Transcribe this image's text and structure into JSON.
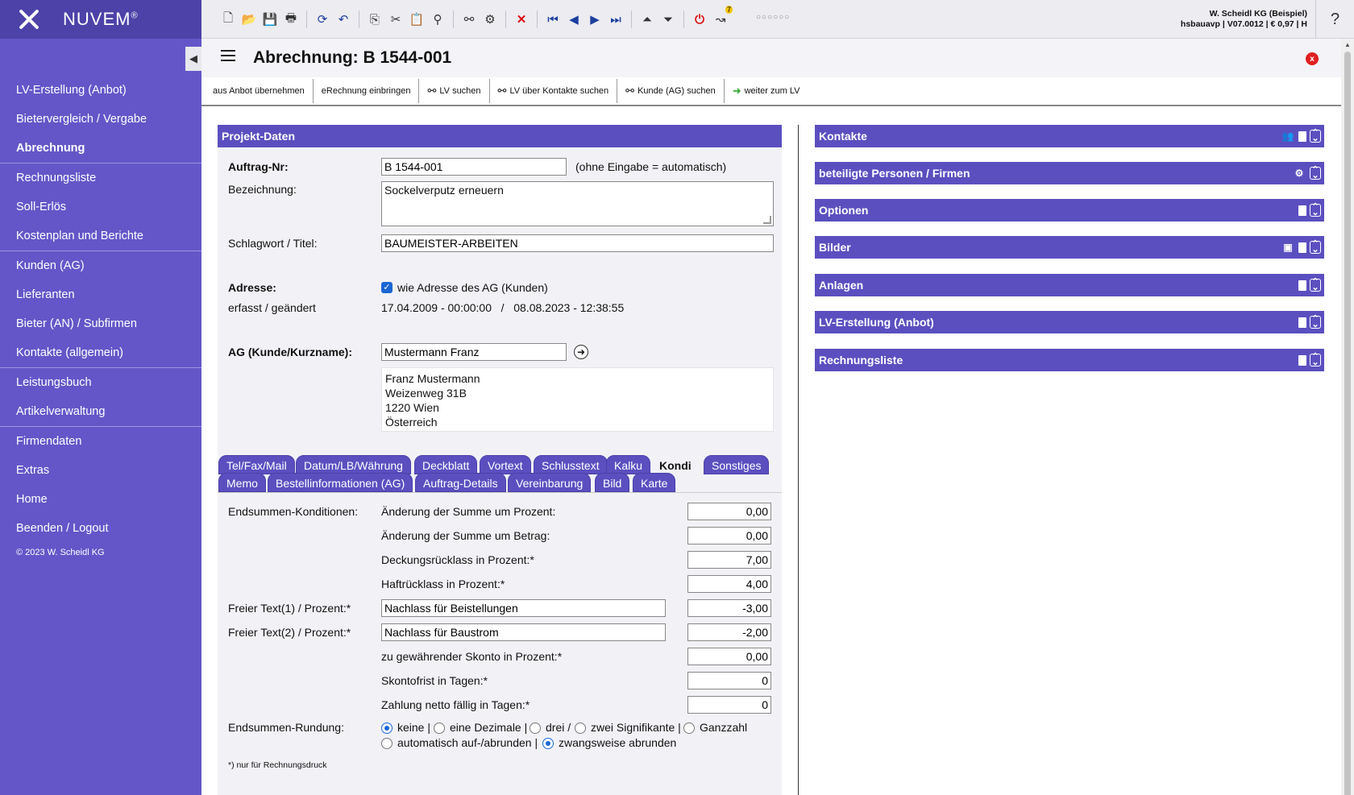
{
  "app": {
    "name": "NUVEM",
    "reg": "®"
  },
  "sidebar": {
    "items": [
      {
        "label": "LV-Erstellung (Anbot)"
      },
      {
        "label": "Bietervergleich / Vergabe"
      },
      {
        "label": "Abrechnung"
      },
      {
        "label": "Rechnungsliste"
      },
      {
        "label": "Soll-Erlös"
      },
      {
        "label": "Kostenplan und Berichte"
      },
      {
        "label": "Kunden (AG)"
      },
      {
        "label": "Lieferanten"
      },
      {
        "label": "Bieter (AN) / Subfirmen"
      },
      {
        "label": "Kontakte (allgemein)"
      },
      {
        "label": "Leistungsbuch"
      },
      {
        "label": "Artikelverwaltung"
      },
      {
        "label": "Firmendaten"
      },
      {
        "label": "Extras"
      },
      {
        "label": "Home"
      },
      {
        "label": "Beenden / Logout"
      }
    ],
    "copyright": "© 2023 W. Scheidl KG"
  },
  "topbar": {
    "company_line1": "W. Scheidl KG (Beispiel)",
    "company_line2": "hsbauavp | V07.0012 | € 0,97 | H",
    "dots": "○○○○○○",
    "help": "?",
    "badge": "7"
  },
  "header": {
    "title": "Abrechnung: B 1544-001",
    "close": "x"
  },
  "actions": [
    {
      "label": "aus Anbot übernehmen"
    },
    {
      "label": "eRechnung einbringen"
    },
    {
      "label": "LV suchen"
    },
    {
      "label": "LV über Kontakte suchen"
    },
    {
      "label": "Kunde (AG) suchen"
    },
    {
      "label": "weiter zum LV"
    }
  ],
  "projekt": {
    "title": "Projekt-Daten",
    "auftrag_label": "Auftrag-Nr:",
    "auftrag_value": "B 1544-001",
    "auftrag_hint": "(ohne Eingabe = automatisch)",
    "bezeichnung_label": "Bezeichnung:",
    "bezeichnung_value": "Sockelverputz erneuern",
    "schlagwort_label": "Schlagwort / Titel:",
    "schlagwort_value": "BAUMEISTER-ARBEITEN",
    "adresse_label": "Adresse:",
    "adresse_check": "wie Adresse des AG (Kunden)",
    "erfasst_label": "erfasst / geändert",
    "erfasst_value": "17.04.2009 - 00:00:00   /   08.08.2023 - 12:38:55",
    "ag_label": "AG (Kunde/Kurzname):",
    "ag_value": "Mustermann Franz",
    "address": [
      "Franz Mustermann",
      "Weizenweg 31B",
      "1220 Wien",
      "Österreich"
    ]
  },
  "tabs_row1": [
    "Tel/Fax/Mail",
    "Datum/LB/Währung",
    "Deckblatt",
    "Vortext",
    "Schlusstext",
    "Kalku",
    "Kondi",
    "Sonstiges"
  ],
  "tabs_row2": [
    "Memo",
    "Bestellinformationen (AG)",
    "Auftrag-Details",
    "Vereinbarung",
    "Bild",
    "Karte"
  ],
  "kondi": {
    "endsummen_label": "Endsummen-Konditionen:",
    "rows": [
      {
        "label": "Änderung der Summe um Prozent:",
        "value": "0,00"
      },
      {
        "label": "Änderung der Summe um Betrag:",
        "value": "0,00"
      },
      {
        "label": "Deckungsrücklass in Prozent:*",
        "value": "7,00"
      },
      {
        "label": "Haftrücklass in Prozent:*",
        "value": "4,00"
      },
      {
        "label": "Freier Text(1) / Prozent:*",
        "text": "Nachlass für Beistellungen",
        "value": "-3,00"
      },
      {
        "label": "Freier Text(2) / Prozent:*",
        "text": "Nachlass für Baustrom",
        "value": "-2,00"
      },
      {
        "label": "zu gewährender Skonto in Prozent:*",
        "value": "0,00"
      },
      {
        "label": "Skontofrist in Tagen:*",
        "value": "0"
      },
      {
        "label": "Zahlung netto fällig in Tagen:*",
        "value": "0"
      }
    ],
    "rundung_label": "Endsummen-Rundung:",
    "rundung_opts1": [
      "keine |",
      "eine Dezimale |",
      "drei /",
      "zwei Signifikante |",
      "Ganzzahl"
    ],
    "rundung_opts2": [
      "automatisch auf-/abrunden |",
      "zwangsweise abrunden"
    ],
    "footnote": "*) nur für Rechnungsdruck"
  },
  "right_panels": [
    {
      "label": "Kontakte"
    },
    {
      "label": "beteiligte Personen / Firmen"
    },
    {
      "label": "Optionen"
    },
    {
      "label": "Bilder"
    },
    {
      "label": "Anlagen"
    },
    {
      "label": "LV-Erstellung (Anbot)"
    },
    {
      "label": "Rechnungsliste"
    }
  ]
}
